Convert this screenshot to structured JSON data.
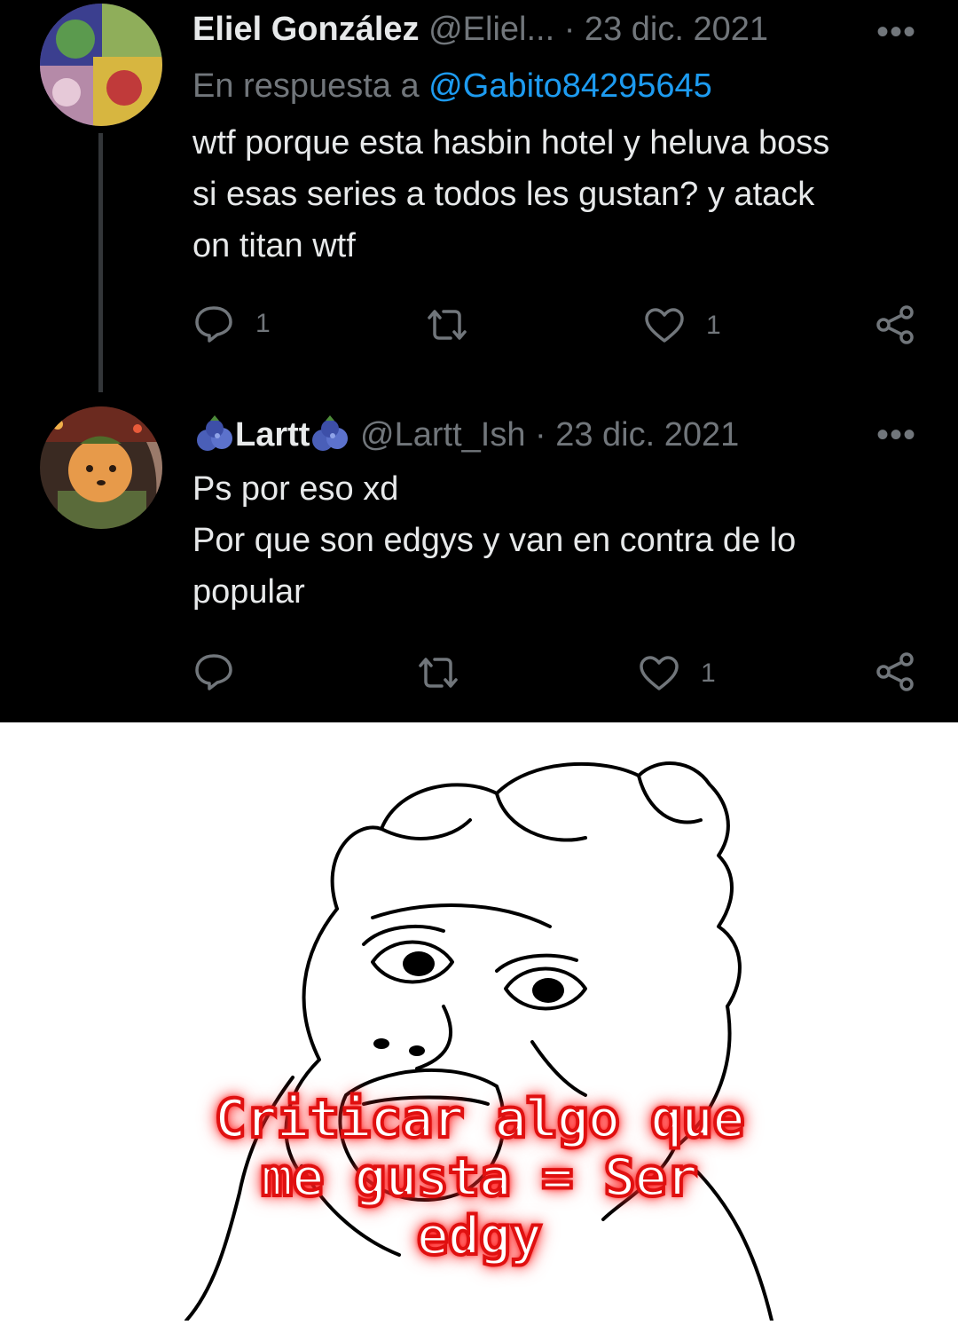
{
  "tweets": [
    {
      "display_name": "Eliel González",
      "handle": "@Eliel...",
      "date": "· 23 dic. 2021",
      "more": "•••",
      "reply_prefix": "En respuesta a",
      "reply_mention": "@Gabito84295645",
      "text_lines": [
        "wtf porque esta hasbin hotel y heluva boss",
        "si esas series a todos les gustan? y atack",
        "on titan wtf"
      ],
      "reply_count": "1",
      "retweet_count": "",
      "like_count": "1"
    },
    {
      "display_name": "Lartt",
      "handle": "@Lartt_Ish",
      "date": "· 23 dic. 2021",
      "more": "•••",
      "text_lines": [
        "Ps por eso xd",
        "Por que son edgys y van en contra de lo",
        "popular"
      ],
      "reply_count": "",
      "retweet_count": "",
      "like_count": "1"
    }
  ],
  "meme": {
    "caption_lines": [
      "Criticar algo que",
      "me gusta = Ser",
      "edgy"
    ]
  },
  "colors": {
    "background": "#000000",
    "text": "#e7e9ea",
    "muted": "#71767b",
    "mention": "#1d9bf0",
    "caption_glow": "#ff0000"
  },
  "icons": [
    "reply-icon",
    "retweet-icon",
    "like-icon",
    "share-icon",
    "blueberry-emoji"
  ]
}
